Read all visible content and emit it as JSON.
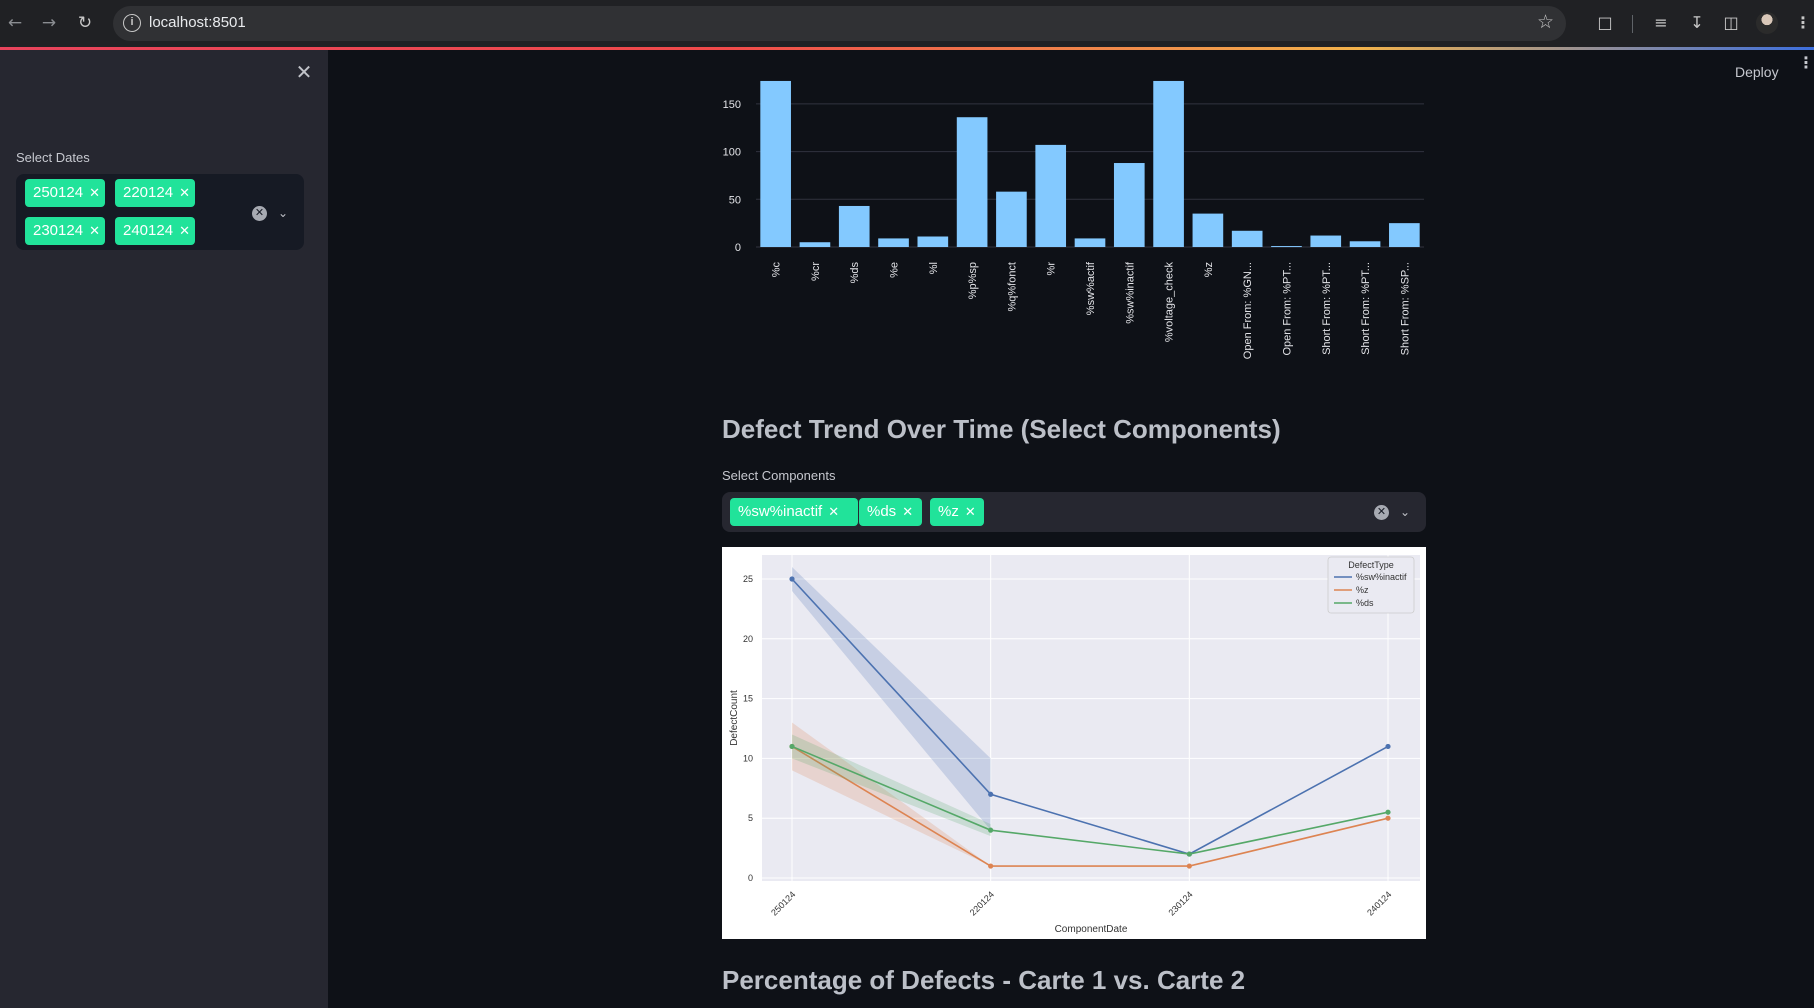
{
  "browser": {
    "url": "localhost:8501",
    "back_icon": "arrow-left",
    "forward_icon": "arrow-right",
    "reload_icon": "reload",
    "info_icon": "info",
    "bookmark_icon": "star"
  },
  "app": {
    "deploy_label": "Deploy",
    "accent_color": "#21e39a"
  },
  "sidebar": {
    "dates_label": "Select Dates",
    "selected_dates": [
      "250124",
      "220124",
      "230124",
      "240124"
    ]
  },
  "trend_section": {
    "title": "Defect Trend Over Time (Select Components)",
    "components_label": "Select Components",
    "selected_components": [
      "%sw%inactif",
      "%ds",
      "%z"
    ]
  },
  "percentage_section": {
    "title": "Percentage of Defects - Carte 1 vs. Carte 2"
  },
  "chart_data": [
    {
      "type": "bar",
      "title": "",
      "xlabel": "",
      "ylabel": "",
      "bar_color": "#83c9ff",
      "ylim": [
        0,
        175
      ],
      "yticks": [
        0,
        50,
        100,
        150
      ],
      "grid": true,
      "categories": [
        "%c",
        "%cr",
        "%ds",
        "%e",
        "%l",
        "%p%sp",
        "%q%fonct",
        "%r",
        "%sw%actif",
        "%sw%inactif",
        "%voltage_check",
        "%z",
        "Open From: %GN...",
        "Open From: %PT...",
        "Short From: %PT...",
        "Short From: %PT...",
        "Short From: %SP..."
      ],
      "values": [
        174,
        5,
        43,
        9,
        11,
        136,
        58,
        107,
        9,
        88,
        174,
        35,
        17,
        1,
        12,
        6,
        25
      ]
    },
    {
      "type": "line",
      "title": "",
      "xlabel": "ComponentDate",
      "ylabel": "DefectCount",
      "ylim": [
        0,
        26
      ],
      "yticks": [
        0,
        5,
        10,
        15,
        20,
        25
      ],
      "grid": true,
      "legend_title": "DefectType",
      "legend_position": "top-right",
      "x": [
        "250124",
        "220124",
        "230124",
        "240124"
      ],
      "series": [
        {
          "name": "%sw%inactif",
          "color": "#4c72b0",
          "values": [
            25,
            7,
            2,
            11
          ],
          "band_low": [
            24,
            4,
            null,
            null
          ],
          "band_high": [
            26,
            10,
            null,
            null
          ]
        },
        {
          "name": "%z",
          "color": "#dd8452",
          "values": [
            11,
            1,
            1,
            5
          ],
          "band_low": [
            9,
            1,
            null,
            null
          ],
          "band_high": [
            13,
            1,
            null,
            null
          ]
        },
        {
          "name": "%ds",
          "color": "#55a868",
          "values": [
            11,
            4,
            2,
            5.5
          ],
          "band_low": [
            10,
            3.5,
            null,
            null
          ],
          "band_high": [
            12,
            4.5,
            null,
            null
          ]
        }
      ]
    }
  ]
}
